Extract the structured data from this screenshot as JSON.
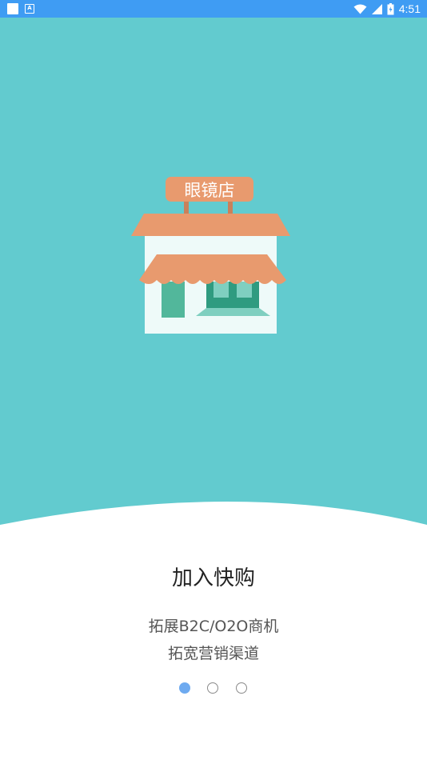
{
  "status_bar": {
    "time": "4:51",
    "left_icons": [
      "notification-square-icon",
      "a-badge-icon"
    ],
    "right_icons": [
      "wifi-icon",
      "cellular-signal-icon",
      "battery-icon"
    ],
    "color": "#3f9cf3"
  },
  "illustration": {
    "sign_text": "眼镜店",
    "background_color": "#62cbcf",
    "awning_color": "#e89a6e",
    "building_color": "#eefaf9"
  },
  "onboarding": {
    "title": "加入快购",
    "subtitle_line1": "拓展B2C/O2O商机",
    "subtitle_line2": "拓宽营销渠道"
  },
  "pager": {
    "active_index": 0,
    "total": 3,
    "active_color": "#6eaaf0"
  }
}
